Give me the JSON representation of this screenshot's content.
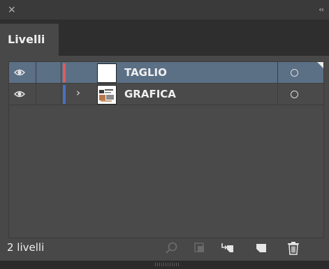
{
  "window": {
    "close_label": "×",
    "collapse_label": "‹‹"
  },
  "tab": {
    "label": "Livelli"
  },
  "layers": [
    {
      "name": "TAGLIO",
      "visible": true,
      "selected": true,
      "color": "#e05b5b",
      "has_children": false,
      "thumbnail": "blank-white"
    },
    {
      "name": "GRAFICA",
      "visible": true,
      "selected": false,
      "color": "#4a6fc2",
      "has_children": true,
      "expand_label": "›",
      "thumbnail": "artwork"
    }
  ],
  "footer": {
    "count_label": "2 livelli"
  },
  "icons": {
    "panel_menu": "hamburger-menu-icon",
    "visibility": "eye-icon",
    "target": "target-circle-icon",
    "locate": "search-icon",
    "clipping_mask": "clipping-mask-icon",
    "new_sublayer": "new-sublayer-icon",
    "new_layer": "new-layer-icon",
    "delete": "trash-icon"
  },
  "colors": {
    "selection": "#5b6f85",
    "panel_bg": "#484848"
  }
}
